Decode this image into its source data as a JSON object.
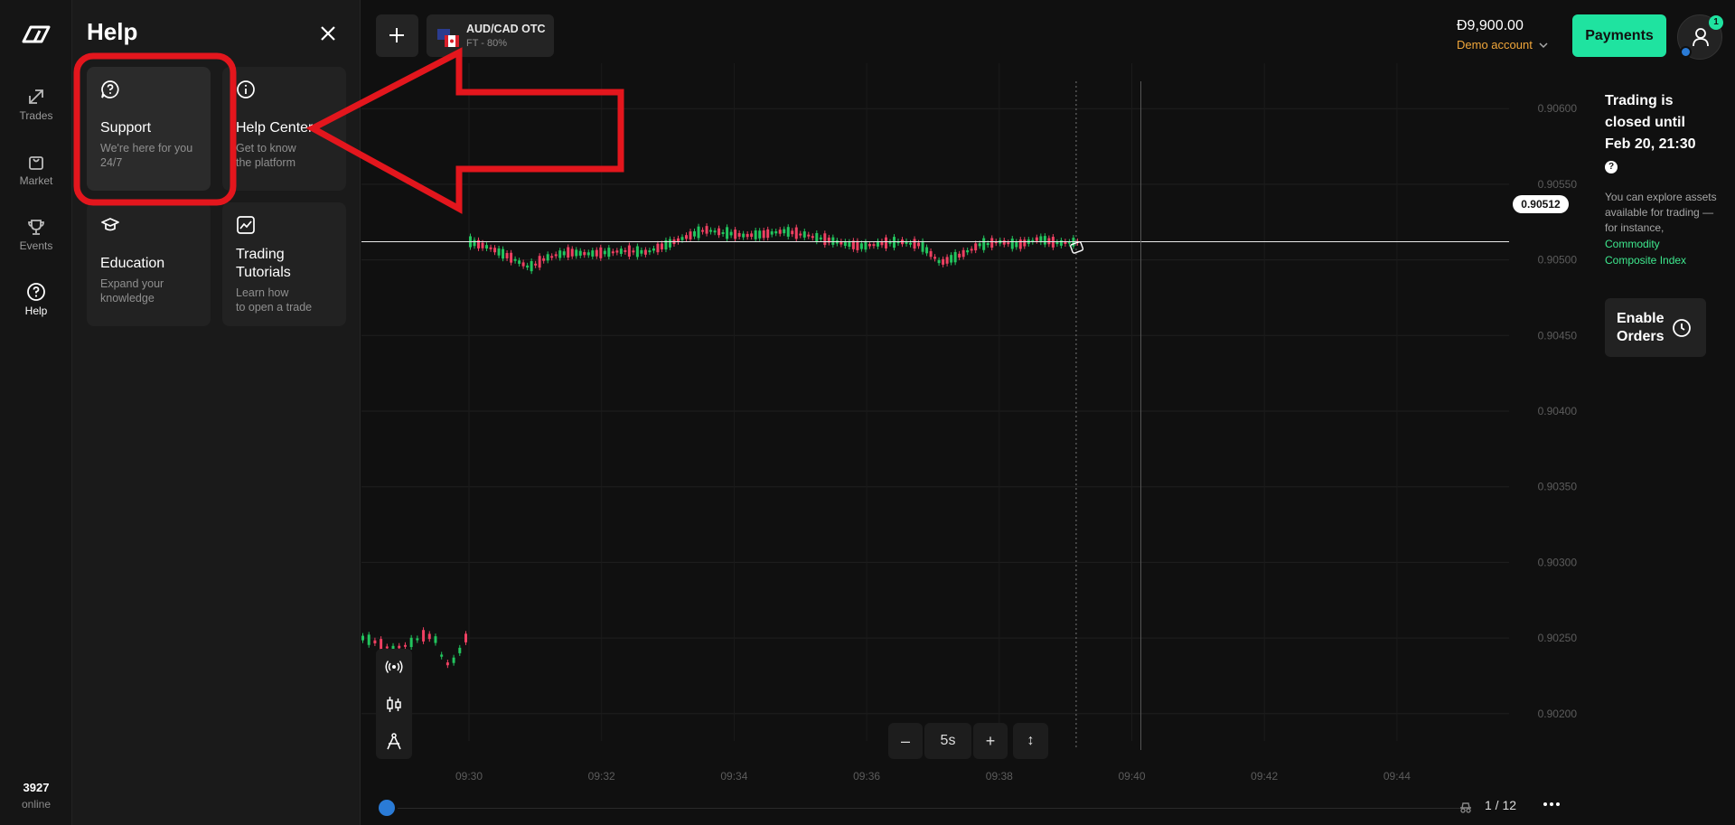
{
  "sidebar": {
    "items": [
      {
        "label": "Trades",
        "icon": "trades-icon"
      },
      {
        "label": "Market",
        "icon": "market-icon"
      },
      {
        "label": "Events",
        "icon": "trophy-icon"
      },
      {
        "label": "Help",
        "icon": "help-icon"
      }
    ],
    "online_count": "3927",
    "online_label": "online"
  },
  "help_panel": {
    "title": "Help",
    "cards": [
      {
        "title": "Support",
        "desc1": "We're here for you",
        "desc2": "24/7",
        "icon": "question-bubble-icon"
      },
      {
        "title": "Help Center",
        "desc1": "Get to know",
        "desc2": "the platform",
        "icon": "info-icon"
      },
      {
        "title": "Education",
        "desc1": "Expand your",
        "desc2": "knowledge",
        "icon": "graduation-cap-icon"
      },
      {
        "title1": "Trading",
        "title2": "Tutorials",
        "desc1": "Learn how",
        "desc2": "to open a trade",
        "icon": "chart-image-icon"
      }
    ]
  },
  "topbar": {
    "asset_name": "AUD/CAD OTC",
    "asset_sub": "FT - 80%",
    "balance": "Đ9,900.00",
    "account": "Demo account",
    "payments_label": "Payments",
    "notification_count": "1"
  },
  "info_panel": {
    "closed_line1": "Trading is",
    "closed_line2": "closed until",
    "closed_line3": "Feb 20, 21:30",
    "help_mark": "?",
    "explore_text": "You can explore assets available for trading — for instance,",
    "link_line1": "Commodity",
    "link_line2": "Composite Index",
    "enable_line1": "Enable",
    "enable_line2": "Orders"
  },
  "zoom": {
    "minus": "–",
    "value": "5s",
    "plus": "+",
    "fit": "↕"
  },
  "pager": "1 / 12",
  "colors": {
    "up": "#22c55e",
    "down": "#ef4062",
    "accent": "#1fe3a0",
    "annotation": "#e3161d"
  },
  "chart_data": {
    "type": "candlestick",
    "current_price": "0.90512",
    "y_ticks": [
      "0.90600",
      "0.90550",
      "0.90500",
      "0.90450",
      "0.90400",
      "0.90350",
      "0.90300",
      "0.90250",
      "0.90200"
    ],
    "x_ticks": [
      "09:30",
      "09:32",
      "09:34",
      "09:36",
      "09:38",
      "09:40",
      "09:42",
      "09:44"
    ],
    "ylim": [
      0.9017,
      0.9063
    ],
    "segments": [
      {
        "from": "09:28:50",
        "to": "09:30:00",
        "close_path": [
          0.9025,
          0.90248,
          0.90245,
          0.90243,
          0.90245,
          0.90248,
          0.90252,
          0.9025,
          0.90232,
          0.90236,
          0.9025
        ]
      },
      {
        "from": "09:30:00",
        "to": "09:39:10",
        "close_path": [
          0.90512,
          0.90508,
          0.90502,
          0.90495,
          0.90502,
          0.90505,
          0.90504,
          0.90505,
          0.90506,
          0.90505,
          0.9051,
          0.90515,
          0.9052,
          0.90518,
          0.90516,
          0.90517,
          0.90519,
          0.90517,
          0.90514,
          0.90511,
          0.90509,
          0.90511,
          0.90512,
          0.9051,
          0.90498,
          0.90503,
          0.9051,
          0.90512,
          0.9051,
          0.90514,
          0.90511,
          0.90512
        ]
      }
    ]
  }
}
